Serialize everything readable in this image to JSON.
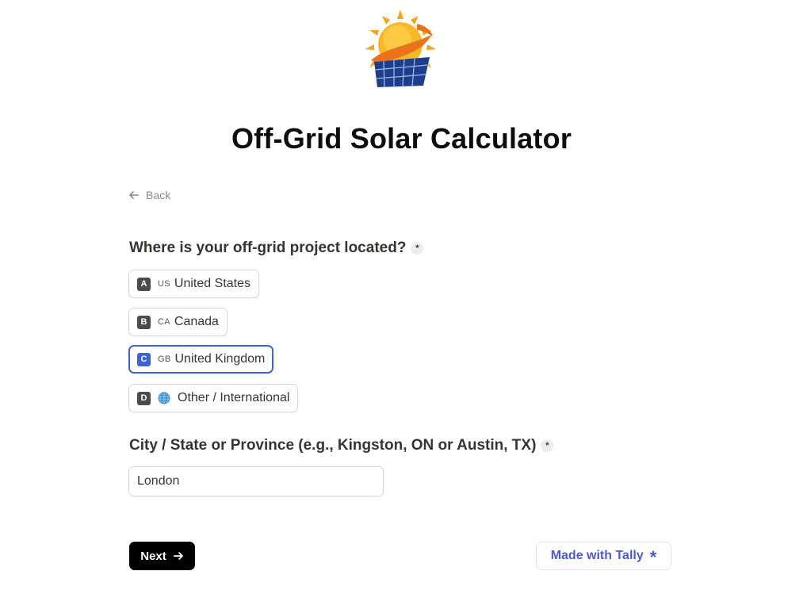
{
  "form": {
    "title": "Off-Grid Solar Calculator",
    "back_label": "Back"
  },
  "question_location": {
    "label": "Where is your off-grid project located?",
    "required_mark": "*",
    "options": [
      {
        "key": "A",
        "flag": "US",
        "label": "United States",
        "selected": false
      },
      {
        "key": "B",
        "flag": "CA",
        "label": "Canada",
        "selected": false
      },
      {
        "key": "C",
        "flag": "GB",
        "label": "United Kingdom",
        "selected": true
      },
      {
        "key": "D",
        "flag": "globe-icon",
        "label": "Other / International",
        "selected": false
      }
    ]
  },
  "question_city": {
    "label": "City / State or Province (e.g., Kingston, ON or Austin, TX)",
    "required_mark": "*",
    "value": "London"
  },
  "footer": {
    "next_label": "Next",
    "made_with_label": "Made with Tally",
    "made_with_mark": "*"
  },
  "colors": {
    "accent": "#3b64d8",
    "tally": "#4a5bd0",
    "button": "#000000"
  }
}
